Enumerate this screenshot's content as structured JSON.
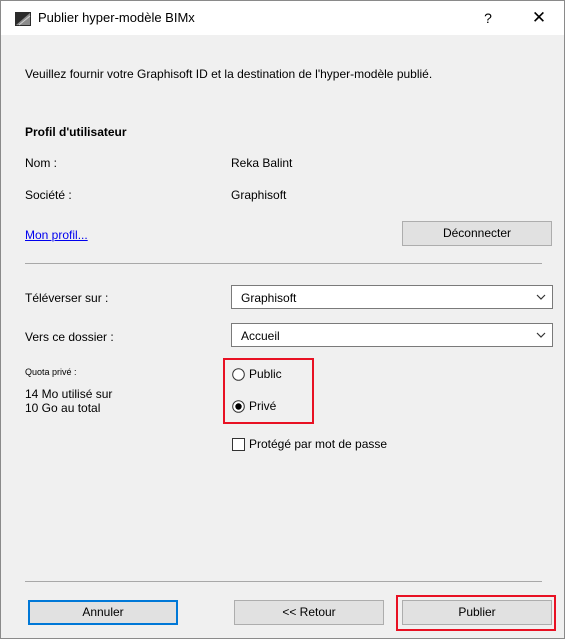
{
  "window": {
    "title": "Publier hyper-modèle BIMx",
    "help": "?",
    "close": "✕"
  },
  "intro": "Veuillez fournir votre Graphisoft ID et la destination de l'hyper-modèle publié.",
  "profile": {
    "heading": "Profil d'utilisateur",
    "name_label": "Nom :",
    "name_value": "Reka Balint",
    "company_label": "Société :",
    "company_value": "Graphisoft",
    "link": "Mon profil...",
    "disconnect": "Déconnecter"
  },
  "upload": {
    "upload_label": "Téléverser sur :",
    "upload_value": "Graphisoft",
    "folder_label": "Vers ce dossier :",
    "folder_value": "Accueil",
    "quota_label": "Quota privé :",
    "quota_line1": "14 Mo utilisé sur",
    "quota_line2": "10 Go au total",
    "public_label": "Public",
    "private_label": "Privé",
    "selected": "Privé",
    "password_label": "Protégé par mot de passe",
    "password_checked": false
  },
  "footer": {
    "cancel": "Annuler",
    "back": "<< Retour",
    "publish": "Publier"
  },
  "colors": {
    "focus": "#0078d7",
    "highlight": "#e81123",
    "link": "#0000ee"
  },
  "icons": {
    "app": "archicad-icon",
    "select_arrow": "chevron-down-icon"
  }
}
